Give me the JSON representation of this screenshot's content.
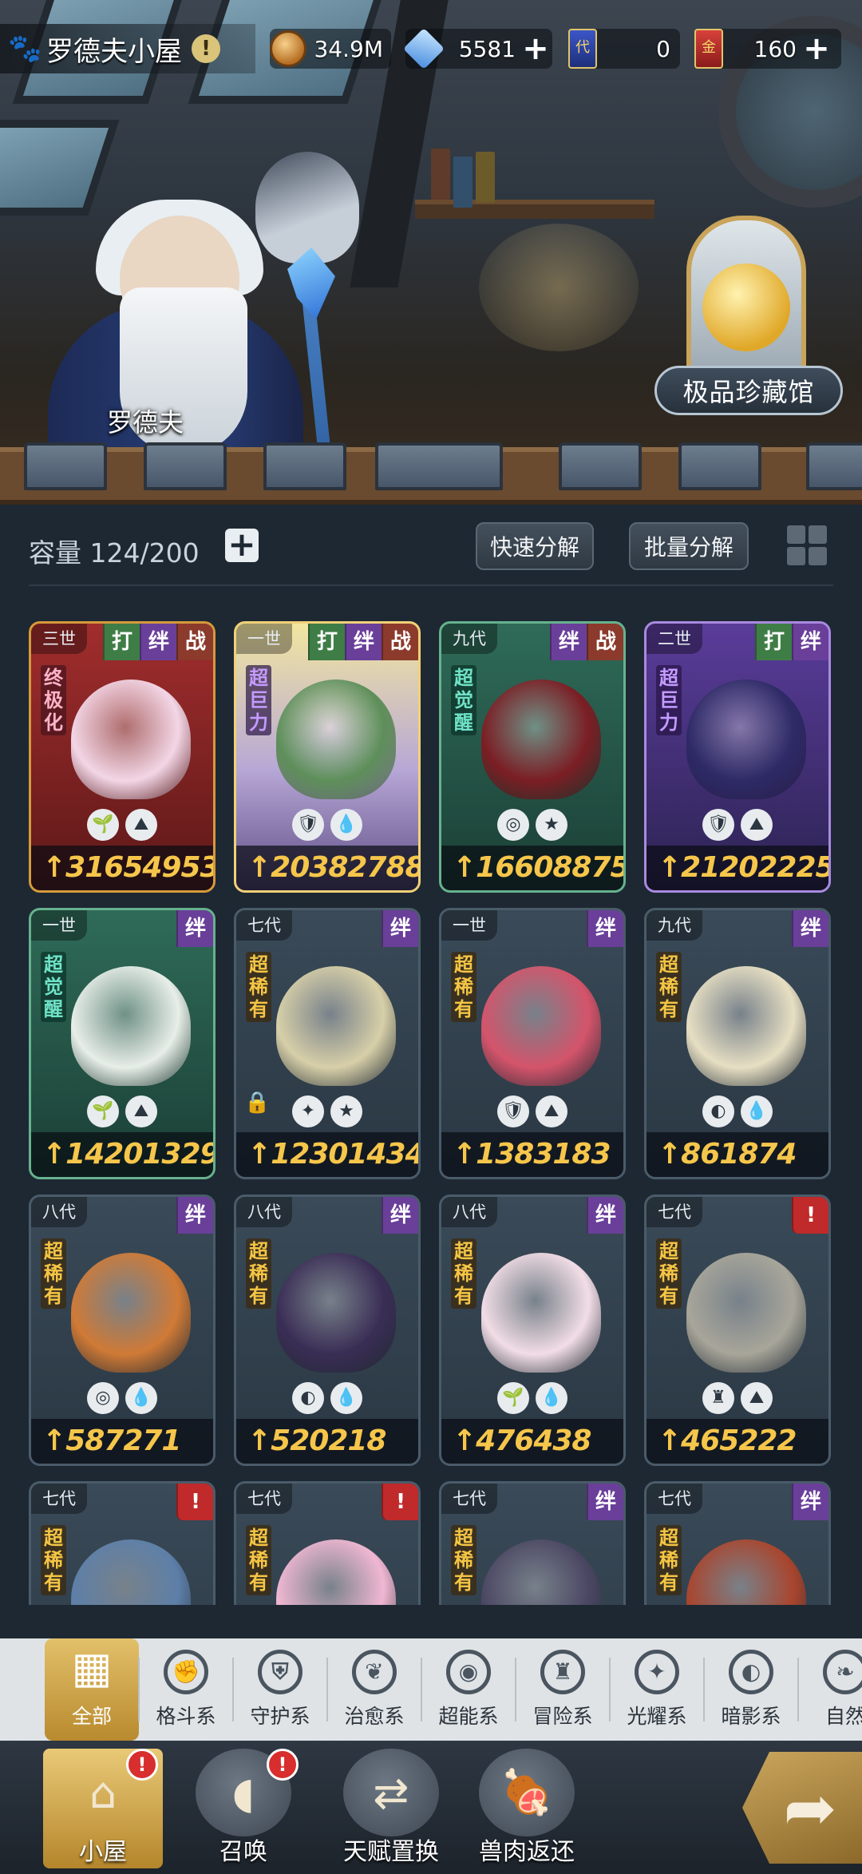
{
  "header": {
    "home_title": "罗德夫小屋",
    "info": "!",
    "resources": [
      {
        "icon": "coin-icon",
        "value": "34.9M"
      },
      {
        "icon": "crystal-icon",
        "value": "5581",
        "plus": "+"
      },
      {
        "icon": "blue-card-icon",
        "badge": "代",
        "value": "0"
      },
      {
        "icon": "red-card-icon",
        "badge": "金",
        "value": "160",
        "plus": "+"
      }
    ]
  },
  "scene": {
    "npc_name": "罗德夫",
    "museum_label": "极品珍藏馆"
  },
  "storage": {
    "capacity_label": "容量 124/200",
    "add": "+",
    "quick_decompose": "快速分解",
    "batch_decompose": "批量分解"
  },
  "cards": [
    {
      "gen": "三世",
      "tags": [
        "打",
        "绊",
        "战"
      ],
      "rarity": "终极化",
      "elems": [
        "🌱",
        "⛰"
      ],
      "power": "31654953",
      "theme": "red",
      "color": "#f3d6e6"
    },
    {
      "gen": "一世",
      "tags": [
        "打",
        "绊",
        "战"
      ],
      "rarity": "超巨力",
      "elems": [
        "🛡",
        "💧"
      ],
      "power": "20382788",
      "theme": "gold",
      "color": "#5e8f5a"
    },
    {
      "gen": "九代",
      "tags": [
        "绊",
        "战"
      ],
      "rarity": "超觉醒",
      "elems": [
        "◎",
        "★"
      ],
      "power": "16608875",
      "theme": "green",
      "color": "#7b1e24"
    },
    {
      "gen": "二世",
      "tags": [
        "打",
        "绊"
      ],
      "rarity": "超巨力",
      "elems": [
        "🛡",
        "⛰"
      ],
      "power": "21202225",
      "theme": "purple",
      "color": "#2d2a66"
    },
    {
      "gen": "一世",
      "tags": [
        "绊"
      ],
      "rarity": "超觉醒",
      "elems": [
        "🌱",
        "⛰"
      ],
      "power": "14201329",
      "theme": "green",
      "color": "#e8eee8"
    },
    {
      "gen": "七代",
      "tags": [
        "绊"
      ],
      "rarity": "超稀有",
      "elems": [
        "✦",
        "★"
      ],
      "power": "12301434",
      "theme": "",
      "color": "#d7cfa8",
      "locked": true
    },
    {
      "gen": "一世",
      "tags": [
        "绊"
      ],
      "rarity": "超稀有",
      "elems": [
        "🛡",
        "⛰"
      ],
      "power": "1383183",
      "theme": "",
      "color": "#d4546b"
    },
    {
      "gen": "九代",
      "tags": [
        "绊"
      ],
      "rarity": "超稀有",
      "elems": [
        "◐",
        "💧"
      ],
      "power": "861874",
      "theme": "",
      "color": "#e7dfc3"
    },
    {
      "gen": "八代",
      "tags": [
        "绊"
      ],
      "rarity": "超稀有",
      "elems": [
        "◎",
        "💧"
      ],
      "power": "587271",
      "theme": "",
      "color": "#d07a36"
    },
    {
      "gen": "八代",
      "tags": [
        "绊"
      ],
      "rarity": "超稀有",
      "elems": [
        "◐",
        "💧"
      ],
      "power": "520218",
      "theme": "",
      "color": "#3a2d55"
    },
    {
      "gen": "八代",
      "tags": [
        "绊"
      ],
      "rarity": "超稀有",
      "elems": [
        "🌱",
        "💧"
      ],
      "power": "476438",
      "theme": "",
      "color": "#f2dde6"
    },
    {
      "gen": "七代",
      "tags": [
        "!"
      ],
      "rarity": "超稀有",
      "elems": [
        "♜",
        "⛰"
      ],
      "power": "465222",
      "theme": "",
      "color": "#a8a69a"
    },
    {
      "gen": "七代",
      "tags": [
        "!"
      ],
      "rarity": "超稀有",
      "elems": [],
      "power": "",
      "theme": "",
      "color": "#5d7fa8"
    },
    {
      "gen": "七代",
      "tags": [
        "!"
      ],
      "rarity": "超稀有",
      "elems": [],
      "power": "",
      "theme": "",
      "color": "#f0b7d2"
    },
    {
      "gen": "七代",
      "tags": [
        "绊"
      ],
      "rarity": "超稀有",
      "elems": [],
      "power": "",
      "theme": "",
      "color": "#4b4763"
    },
    {
      "gen": "七代",
      "tags": [
        "绊"
      ],
      "rarity": "超稀有",
      "elems": [],
      "power": "",
      "theme": "",
      "color": "#a9452e"
    }
  ],
  "categories": [
    {
      "label": "全部",
      "icon": "grid-icon",
      "glyph": "▦",
      "active": true
    },
    {
      "label": "格斗系",
      "icon": "fist-icon",
      "glyph": "✊"
    },
    {
      "label": "守护系",
      "icon": "shield-icon",
      "glyph": "⛨"
    },
    {
      "label": "治愈系",
      "icon": "sprout-icon",
      "glyph": "❦"
    },
    {
      "label": "超能系",
      "icon": "alien-icon",
      "glyph": "◉"
    },
    {
      "label": "冒险系",
      "icon": "lantern-icon",
      "glyph": "♜"
    },
    {
      "label": "光耀系",
      "icon": "star-icon",
      "glyph": "✦"
    },
    {
      "label": "暗影系",
      "icon": "eclipse-icon",
      "glyph": "◐"
    },
    {
      "label": "自然",
      "icon": "leaf-icon",
      "glyph": "❧"
    }
  ],
  "nav": [
    {
      "label": "小屋",
      "icon": "house-icon",
      "glyph": "⌂",
      "badge": "!",
      "active": true
    },
    {
      "label": "召唤",
      "icon": "egg-icon",
      "glyph": "◖",
      "badge": "!"
    },
    {
      "label": "天赋置换",
      "icon": "swap-icon",
      "glyph": "⇄"
    },
    {
      "label": "兽肉返还",
      "icon": "meat-icon",
      "glyph": "🍖"
    }
  ],
  "go_button": "➦"
}
